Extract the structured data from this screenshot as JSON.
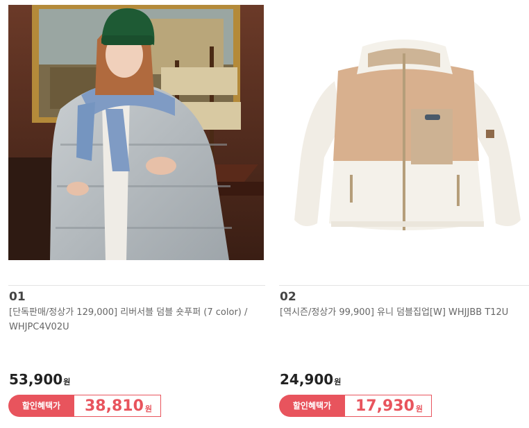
{
  "products": [
    {
      "number": "01",
      "title": "[단독판매/정상가 129,000] 리버서블 덤블 숏푸퍼 (7 color) / WHJPC4V02U",
      "price": "53,900",
      "price_unit": "원",
      "discount_label": "할인혜택가",
      "discount_price": "38,810",
      "discount_unit": "원",
      "image_icon": "model-wearing-puffer-jacket-photo"
    },
    {
      "number": "02",
      "title": "[역시즌/정상가 99,900] 유니 덤블집업[W] WHJJBB T12U",
      "price": "24,900",
      "price_unit": "원",
      "discount_label": "할인혜택가",
      "discount_price": "17,930",
      "discount_unit": "원",
      "image_icon": "fleece-zip-up-jacket-photo"
    }
  ],
  "colors": {
    "accent": "#e8545d",
    "price_text": "#222222",
    "title_text": "#666666"
  }
}
